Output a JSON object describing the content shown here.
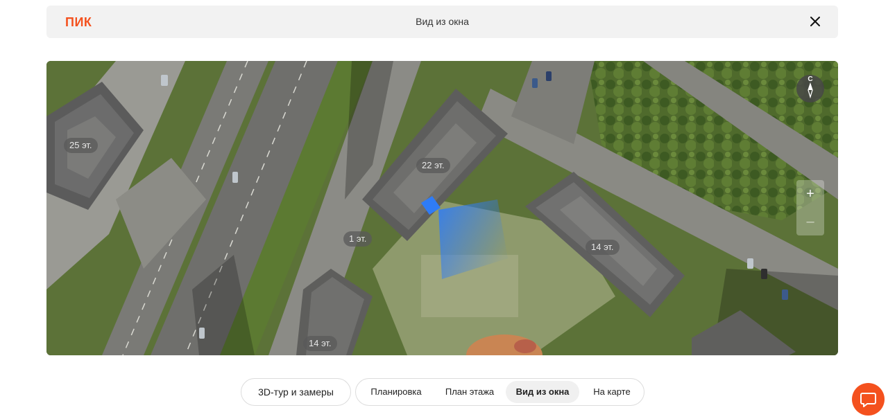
{
  "header": {
    "logo": "ПИК",
    "title": "Вид из окна"
  },
  "map": {
    "floor_labels": [
      "25 эт.",
      "22 эт.",
      "1 эт.",
      "14 эт.",
      "14 эт."
    ],
    "compass_letter": "С",
    "zoom_in": "+",
    "zoom_out": "–"
  },
  "tabs": {
    "tour": "3D-тур и замеры",
    "items": [
      "Планировка",
      "План этажа",
      "Вид из окна",
      "На карте"
    ],
    "active": "Вид из окна"
  },
  "colors": {
    "accent": "#f4511e",
    "view_cone": "#2f7cf6"
  }
}
